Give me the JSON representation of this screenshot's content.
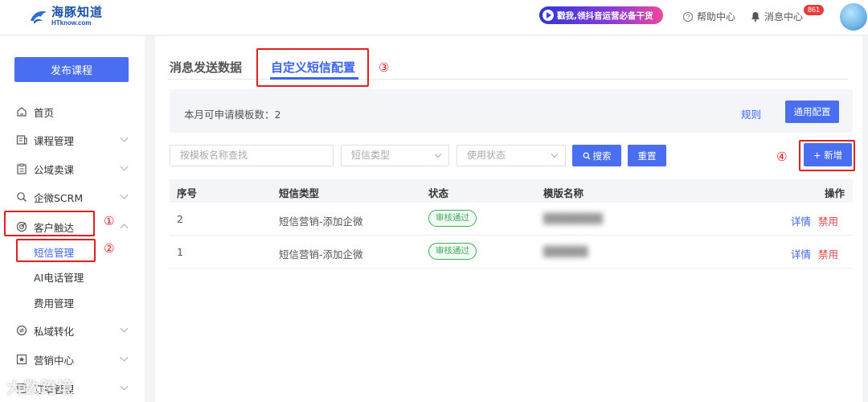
{
  "header": {
    "logo_name": "海豚知道",
    "logo_sub": "HTknow.com",
    "promo_text": "戳我,领抖音运营必备干货",
    "help_label": "帮助中心",
    "message_label": "消息中心",
    "message_count": "861",
    "colors": {
      "logo": "#1a53a8",
      "badge": "#e83a3a"
    }
  },
  "sidebar": {
    "publish_label": "发布课程",
    "items": [
      {
        "label": "首页",
        "icon": "home-icon"
      },
      {
        "label": "课程管理",
        "icon": "course-icon"
      },
      {
        "label": "公域卖课",
        "icon": "clipboard-icon"
      },
      {
        "label": "企微SCRM",
        "icon": "search-person-icon"
      },
      {
        "label": "客户触达",
        "icon": "target-icon",
        "expanded": true
      },
      {
        "label": "私域转化",
        "icon": "convert-icon"
      },
      {
        "label": "营销中心",
        "icon": "star-icon"
      },
      {
        "label": "订单管理",
        "icon": "order-icon"
      }
    ],
    "sub_items": [
      {
        "label": "短信管理",
        "active": true
      },
      {
        "label": "AI电话管理"
      },
      {
        "label": "费用管理"
      }
    ]
  },
  "main": {
    "tabs": [
      {
        "label": "消息发送数据"
      },
      {
        "label": "自定义短信配置",
        "active": true
      }
    ],
    "info_text": "本月可申请模板数：2",
    "rule_link": "规则",
    "general_config": "通用配置",
    "search_placeholder": "按模板名称查找",
    "sms_type_placeholder": "短信类型",
    "usage_status_placeholder": "使用状态",
    "search_button": "搜索",
    "reset_button": "重置",
    "add_button": "+ 新增",
    "columns": [
      "序号",
      "短信类型",
      "状态",
      "模版名称",
      "操作"
    ],
    "rows": [
      {
        "index": "2",
        "type": "短信营销-添加企微",
        "status": "审核通过",
        "template_name": "████████",
        "detail": "详情",
        "disable": "禁用"
      },
      {
        "index": "1",
        "type": "短信营销-添加企微",
        "status": "审核通过",
        "template_name": "██████",
        "detail": "详情",
        "disable": "禁用"
      }
    ],
    "accent": "#3b64ee"
  },
  "annotations": [
    "①",
    "②",
    "③",
    "④"
  ],
  "watermark": "大数跨境"
}
